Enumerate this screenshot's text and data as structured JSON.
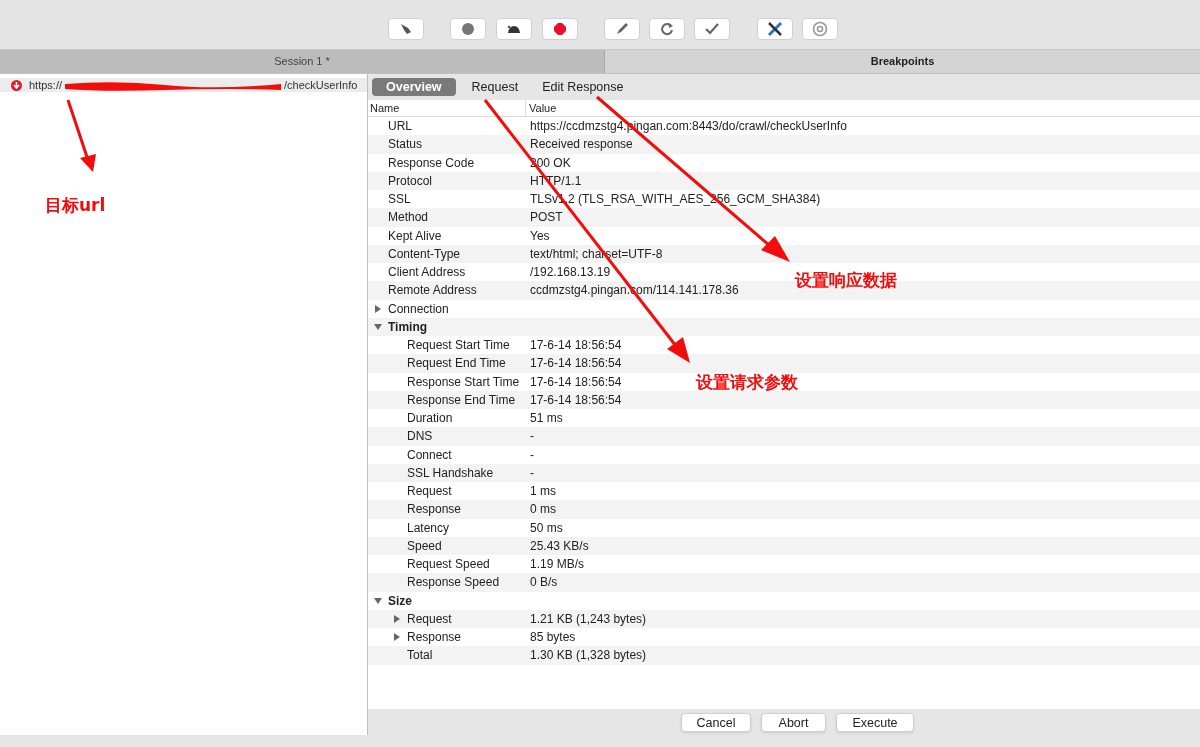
{
  "window_tabs": [
    {
      "label": "Session 1 *",
      "selected": false
    },
    {
      "label": "Breakpoints",
      "selected": true
    }
  ],
  "session_list": [
    {
      "url_start": "https://",
      "url_end": "/checkUserInfo",
      "selected": true
    }
  ],
  "detail_tabs": [
    {
      "label": "Overview",
      "selected": true
    },
    {
      "label": "Request",
      "selected": false
    },
    {
      "label": "Edit Response",
      "selected": false
    }
  ],
  "table": {
    "columns": [
      "Name",
      "Value"
    ],
    "rows": [
      {
        "name": "URL",
        "value": "https://ccdmzstg4.pingan.com:8443/do/crawl/checkUserInfo"
      },
      {
        "name": "Status",
        "value": "Received response"
      },
      {
        "name": "Response Code",
        "value": "200 OK"
      },
      {
        "name": "Protocol",
        "value": "HTTP/1.1"
      },
      {
        "name": "SSL",
        "value": "TLSv1.2 (TLS_RSA_WITH_AES_256_GCM_SHA384)"
      },
      {
        "name": "Method",
        "value": "POST"
      },
      {
        "name": "Kept Alive",
        "value": "Yes"
      },
      {
        "name": "Content-Type",
        "value": "text/html; charset=UTF-8"
      },
      {
        "name": "Client Address",
        "value": "/192.168.13.19"
      },
      {
        "name": "Remote Address",
        "value": "ccdmzstg4.pingan.com/114.141.178.36"
      },
      {
        "name": "Connection",
        "expanded": false
      },
      {
        "name": "Timing",
        "expanded": true,
        "children": [
          {
            "name": "Request Start Time",
            "value": "17-6-14 18:56:54"
          },
          {
            "name": "Request End Time",
            "value": "17-6-14 18:56:54"
          },
          {
            "name": "Response Start Time",
            "value": "17-6-14 18:56:54"
          },
          {
            "name": "Response End Time",
            "value": "17-6-14 18:56:54"
          },
          {
            "name": "Duration",
            "value": "51 ms"
          },
          {
            "name": "DNS",
            "value": "-"
          },
          {
            "name": "Connect",
            "value": "-"
          },
          {
            "name": "SSL Handshake",
            "value": "-"
          },
          {
            "name": "Request",
            "value": "1 ms"
          },
          {
            "name": "Response",
            "value": "0 ms"
          },
          {
            "name": "Latency",
            "value": "50 ms"
          },
          {
            "name": "Speed",
            "value": "25.43 KB/s"
          },
          {
            "name": "Request Speed",
            "value": "1.19 MB/s"
          },
          {
            "name": "Response Speed",
            "value": "0 B/s"
          }
        ]
      },
      {
        "name": "Size",
        "expanded": true,
        "children": [
          {
            "name": "Request",
            "value": "1.21 KB (1,243 bytes)",
            "expanded": false
          },
          {
            "name": "Response",
            "value": "85 bytes",
            "expanded": false
          },
          {
            "name": "Total",
            "value": "1.30 KB (1,328 bytes)"
          }
        ]
      }
    ]
  },
  "buttons": [
    "Cancel",
    "Abort",
    "Execute"
  ],
  "annotations": [
    {
      "text": "目标url"
    },
    {
      "text": "设置响应数据"
    },
    {
      "text": "设置请求参数"
    }
  ]
}
